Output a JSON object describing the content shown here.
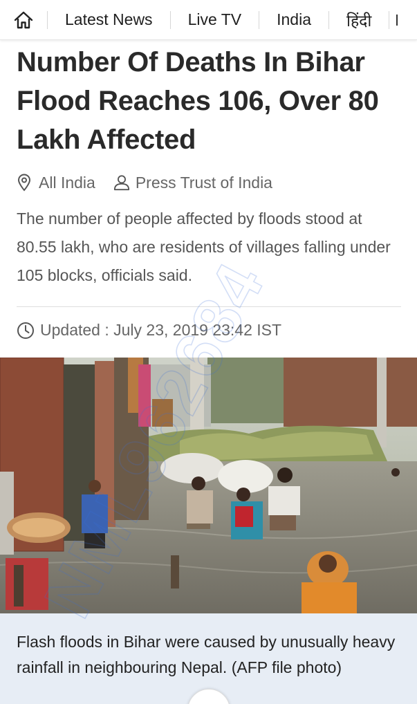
{
  "nav": {
    "items": [
      "Latest News",
      "Live TV",
      "India",
      "हिंदी"
    ]
  },
  "article": {
    "headline": "Number Of Deaths In Bihar Flood Reaches 106, Over 80 Lakh Affected",
    "location": "All India",
    "author": "Press Trust of India",
    "summary": "The number of people affected by floods stood at 80.55 lakh, who are residents of villages falling under 105 blocks, officials said.",
    "updated": "Updated : July 23, 2019 23:42 IST",
    "caption": "Flash floods in Bihar were caused by unusually heavy rainfall in neighbouring Nepal. (AFP file photo)"
  },
  "watermark": "NML962684",
  "icons": {
    "home": "home-icon",
    "location": "location-pin-icon",
    "author": "person-icon",
    "updated": "clock-icon"
  },
  "colors": {
    "caption_bg": "#e7edf5",
    "water": "#8b8a80",
    "watermark": "#3a6fd8"
  }
}
